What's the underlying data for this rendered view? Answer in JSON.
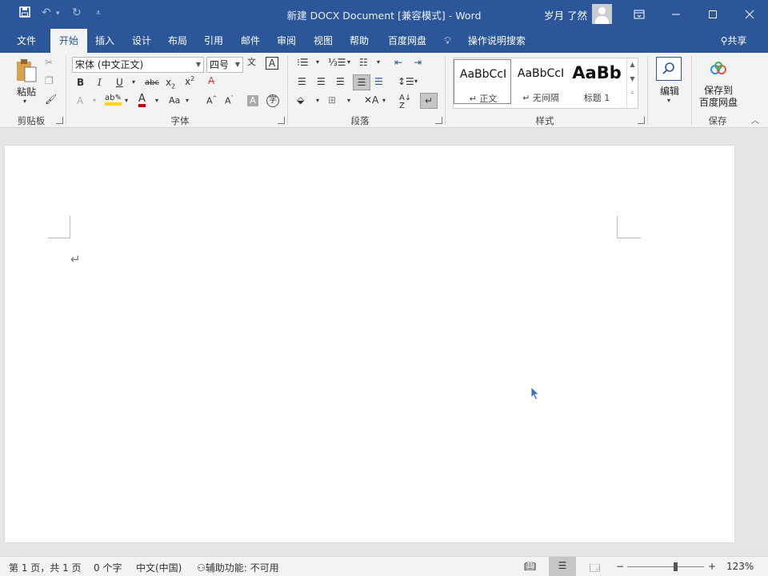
{
  "titlebar": {
    "doc_title": "新建 DOCX Document [兼容模式]  -  Word",
    "user": "岁月 了然",
    "save_icon": "save-icon",
    "undo_icon": "undo-icon",
    "redo_icon": "redo-icon",
    "customize_icon": "customize-icon"
  },
  "tabs": [
    {
      "label": "文件"
    },
    {
      "label": "开始"
    },
    {
      "label": "插入"
    },
    {
      "label": "设计"
    },
    {
      "label": "布局"
    },
    {
      "label": "引用"
    },
    {
      "label": "邮件"
    },
    {
      "label": "审阅"
    },
    {
      "label": "视图"
    },
    {
      "label": "帮助"
    },
    {
      "label": "百度网盘"
    }
  ],
  "tell_me": "操作说明搜索",
  "share": "共享",
  "ribbon": {
    "clipboard": {
      "paste": "粘贴",
      "label": "剪贴板"
    },
    "font": {
      "font_name": "宋体 (中文正文)",
      "font_size": "四号",
      "label": "字体"
    },
    "paragraph": {
      "label": "段落"
    },
    "styles": {
      "label": "样式",
      "items": [
        {
          "sample": "AaBbCcI",
          "name": "↵ 正文"
        },
        {
          "sample": "AaBbCcI",
          "name": "↵ 无间隔"
        },
        {
          "sample": "AaBb",
          "name": "标题 1"
        }
      ]
    },
    "editing": {
      "label": "编辑"
    },
    "save": {
      "line1": "保存到",
      "line2": "百度网盘",
      "label": "保存"
    }
  },
  "document": {
    "paragraph_mark": "↵"
  },
  "statusbar": {
    "page": "第 1 页，共 1 页",
    "words": "0 个字",
    "language": "中文(中国)",
    "accessibility": "辅助功能: 不可用",
    "zoom": "123%",
    "zoom_level": 0.62
  }
}
